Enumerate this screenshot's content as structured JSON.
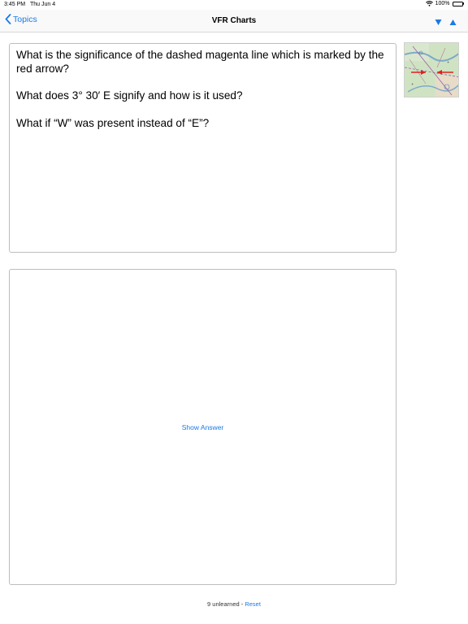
{
  "status_bar": {
    "time": "3:45 PM",
    "date": "Thu Jun 4",
    "battery": "100%",
    "battery_level": 1.0
  },
  "nav": {
    "back_label": "Topics",
    "title": "VFR Charts",
    "icons": [
      "chevron-left-icon",
      "arrow-down-icon",
      "arrow-up-icon"
    ]
  },
  "question": {
    "lines": [
      "What is the significance of the dashed magenta line which is marked by the red arrow?",
      "What does 3° 30′ E signify and how is it used?",
      "What if “W” was present instead of “E”?"
    ]
  },
  "answer": {
    "show_label": "Show Answer"
  },
  "footer": {
    "count_text": "9 unlearned - ",
    "reset_label": "Reset"
  },
  "colors": {
    "accent": "#1a7ae8",
    "arrow_red": "#e02020"
  }
}
